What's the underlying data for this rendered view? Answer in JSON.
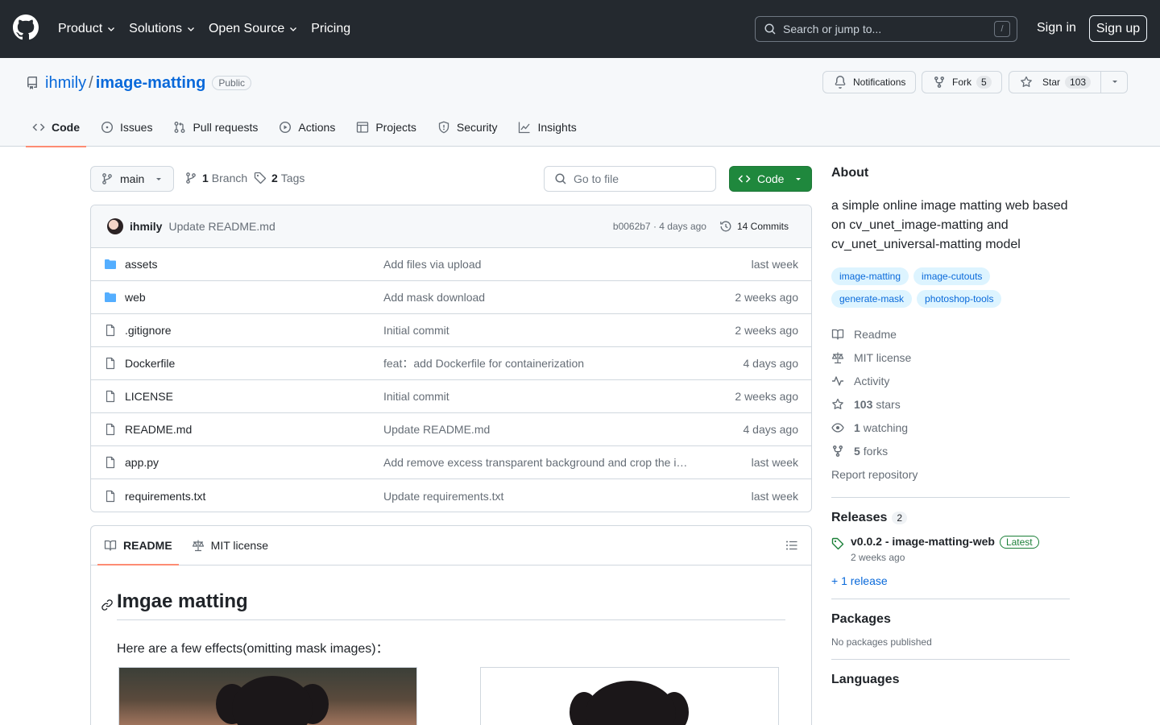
{
  "header": {
    "nav": [
      "Product",
      "Solutions",
      "Open Source",
      "Pricing"
    ],
    "search_placeholder": "Search or jump to...",
    "search_key": "/",
    "signin": "Sign in",
    "signup": "Sign up"
  },
  "repo": {
    "owner": "ihmily",
    "sep": "/",
    "name": "image-matting",
    "visibility": "Public",
    "notifications": "Notifications",
    "fork_label": "Fork",
    "fork_count": "5",
    "star_label": "Star",
    "star_count": "103"
  },
  "tabs": [
    {
      "label": "Code",
      "icon": "code-icon"
    },
    {
      "label": "Issues",
      "icon": "issue-icon"
    },
    {
      "label": "Pull requests",
      "icon": "pull-request-icon"
    },
    {
      "label": "Actions",
      "icon": "play-icon"
    },
    {
      "label": "Projects",
      "icon": "table-icon"
    },
    {
      "label": "Security",
      "icon": "shield-icon"
    },
    {
      "label": "Insights",
      "icon": "graph-icon"
    }
  ],
  "toolbar": {
    "branch": "main",
    "branch_count": "1",
    "branch_label": "Branch",
    "tag_count": "2",
    "tag_label": "Tags",
    "goto_placeholder": "Go to file",
    "code_label": "Code"
  },
  "commit": {
    "author": "ihmily",
    "message": "Update README.md",
    "sha_time": "b0062b7 · 4 days ago",
    "commits": "14 Commits"
  },
  "files": [
    {
      "name": "assets",
      "type": "dir",
      "message": "Add files via upload",
      "date": "last week"
    },
    {
      "name": "web",
      "type": "dir",
      "message": "Add mask download",
      "date": "2 weeks ago"
    },
    {
      "name": ".gitignore",
      "type": "file",
      "message": "Initial commit",
      "date": "2 weeks ago"
    },
    {
      "name": "Dockerfile",
      "type": "file",
      "message": "feat：add Dockerfile for containerization",
      "date": "4 days ago"
    },
    {
      "name": "LICENSE",
      "type": "file",
      "message": "Initial commit",
      "date": "2 weeks ago"
    },
    {
      "name": "README.md",
      "type": "file",
      "message": "Update README.md",
      "date": "4 days ago"
    },
    {
      "name": "app.py",
      "type": "file",
      "message": "Add remove excess transparent background and crop the i…",
      "date": "last week"
    },
    {
      "name": "requirements.txt",
      "type": "file",
      "message": "Update requirements.txt",
      "date": "last week"
    }
  ],
  "readme": {
    "tab_readme": "README",
    "tab_license": "MIT license",
    "heading": "Imgae matting",
    "paragraph": "Here are a few effects(omitting mask images)："
  },
  "about": {
    "title": "About",
    "description": "a simple online image matting web based on cv_unet_image-matting and cv_unet_universal-matting model",
    "topics": [
      "image-matting",
      "image-cutouts",
      "generate-mask",
      "photoshop-tools"
    ],
    "readme": "Readme",
    "license": "MIT license",
    "activity": "Activity",
    "stars_count": "103",
    "stars_label": "stars",
    "watching_count": "1",
    "watching_label": "watching",
    "forks_count": "5",
    "forks_label": "forks",
    "report": "Report repository"
  },
  "releases": {
    "title": "Releases",
    "count": "2",
    "latest_name": "v0.0.2 - image-matting-web",
    "latest_badge": "Latest",
    "latest_date": "2 weeks ago",
    "more": "+ 1 release"
  },
  "packages": {
    "title": "Packages",
    "note": "No packages published"
  },
  "languages": {
    "title": "Languages"
  }
}
